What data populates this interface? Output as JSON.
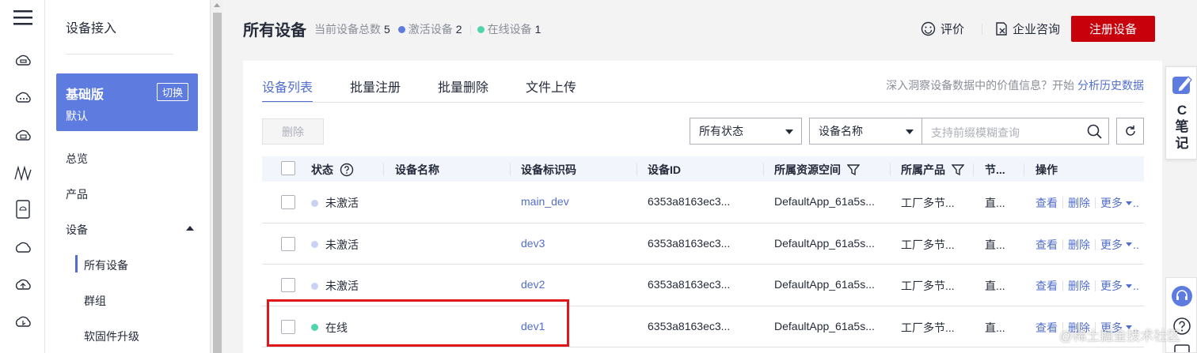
{
  "rail": {
    "icons": [
      "menu-icon",
      "cloud-chat-icon",
      "cloud-dots-icon",
      "cloud-box-icon",
      "signal-wave-icon",
      "device-card-icon",
      "cloud-icon",
      "cloud-upload-icon",
      "cloud-settings-icon"
    ]
  },
  "nav": {
    "title": "设备接入",
    "edition": {
      "name": "基础版",
      "sub": "默认",
      "switch_label": "切换"
    },
    "items": {
      "overview": "总览",
      "product": "产品",
      "device": "设备",
      "all_devices": "所有设备",
      "group": "群组",
      "firmware": "软固件升级"
    }
  },
  "header": {
    "title": "所有设备",
    "total_label": "当前设备总数",
    "total_count": "5",
    "active_label": "激活设备",
    "active_count": "2",
    "online_label": "在线设备",
    "online_count": "1",
    "rate_label": "评价",
    "consult_label": "企业咨询",
    "register_label": "注册设备"
  },
  "colors": {
    "accent": "#526ecc",
    "brand_red": "#c7000b",
    "active_dot": "#5e7ce0",
    "online_dot": "#50d4ab",
    "inactive_dot": "#c9d2f5",
    "highlight": "#e0171b"
  },
  "tabs": [
    "设备列表",
    "批量注册",
    "批量删除",
    "文件上传"
  ],
  "insight": {
    "text": "深入洞察设备数据中的价值信息？开始",
    "link": "分析历史数据"
  },
  "toolbar": {
    "delete_label": "删除",
    "status_select": "所有状态",
    "field_select": "设备名称",
    "search_placeholder": "支持前缀模糊查询"
  },
  "table": {
    "headers": {
      "status": "状态",
      "name": "设备名称",
      "identifier": "设备标识码",
      "id": "设备ID",
      "space": "所属资源空间",
      "product": "所属产品",
      "node": "节...",
      "ops": "操作"
    },
    "rows": [
      {
        "status": "未激活",
        "identifier": "main_dev",
        "id": "6353a8163ec3...",
        "space": "DefaultApp_61a5s...",
        "product": "工厂多节...",
        "node": "直...",
        "view": "查看",
        "delete": "删除",
        "more": "更多"
      },
      {
        "status": "未激活",
        "identifier": "dev3",
        "id": "6353a8163ec3...",
        "space": "DefaultApp_61a5s...",
        "product": "工厂多节...",
        "node": "直...",
        "view": "查看",
        "delete": "删除",
        "more": "更多"
      },
      {
        "status": "未激活",
        "identifier": "dev2",
        "id": "6353a8163ec3...",
        "space": "DefaultApp_61a5s...",
        "product": "工厂多节...",
        "node": "直...",
        "view": "查看",
        "delete": "删除",
        "more": "更多"
      },
      {
        "status": "在线",
        "identifier": "dev1",
        "id": "6353a8163ec3...",
        "space": "DefaultApp_61a5s...",
        "product": "工厂多节...",
        "node": "直...",
        "view": "查看",
        "delete": "删除",
        "more": "更多"
      }
    ]
  },
  "note_widget": {
    "text": "C笔记"
  },
  "watermark": "@稀土掘金技术社区"
}
